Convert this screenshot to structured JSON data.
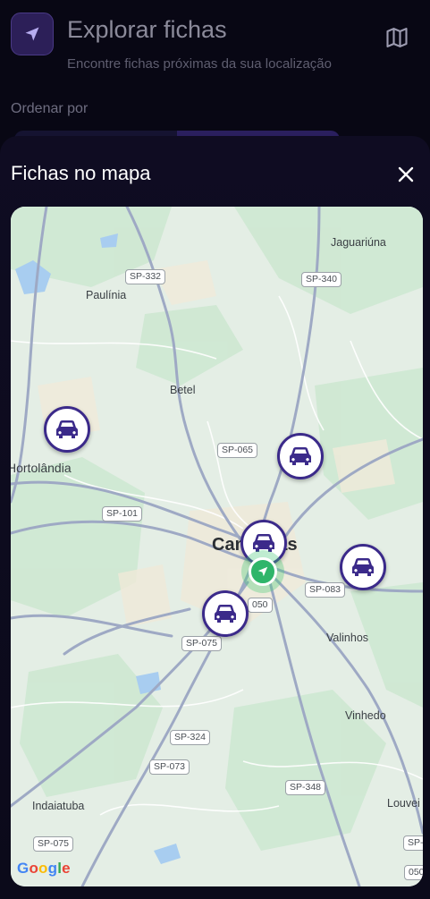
{
  "header": {
    "title": "Explorar fichas",
    "subtitle": "Encontre fichas próximas da sua localização",
    "sort_label": "Ordenar por"
  },
  "sheet": {
    "title": "Fichas no mapa"
  },
  "map": {
    "cities": {
      "jaguariuna": "Jaguariúna",
      "paulinia": "Paulínia",
      "betel": "Betel",
      "hortolandia": "Hortolândia",
      "campinas": "Campinas",
      "valinhos": "Valinhos",
      "vinhedo": "Vinhedo",
      "indaiatuba": "Indaiatuba",
      "louveira": "Louvei"
    },
    "roads": {
      "sp332": "SP-332",
      "sp340": "SP-340",
      "sp065": "SP-065",
      "sp101": "SP-101",
      "sp083": "SP-083",
      "sp075a": "SP-075",
      "sp050": "050",
      "sp324": "SP-324",
      "sp073": "SP-073",
      "sp348": "SP-348",
      "sp075b": "SP-075",
      "sp050b": "050",
      "sp_edge": "SP-"
    },
    "google_letters": [
      "G",
      "o",
      "o",
      "g",
      "l",
      "e"
    ],
    "google_colors": [
      "#4285F4",
      "#EA4335",
      "#FBBC05",
      "#4285F4",
      "#34A853",
      "#EA4335"
    ]
  },
  "colors": {
    "accent": "#3b2a8a",
    "location": "#2fb56a"
  },
  "icons": {
    "app": "navigation-arrow-icon",
    "map_toggle": "map-icon",
    "close": "close-icon",
    "pin": "car-icon"
  }
}
